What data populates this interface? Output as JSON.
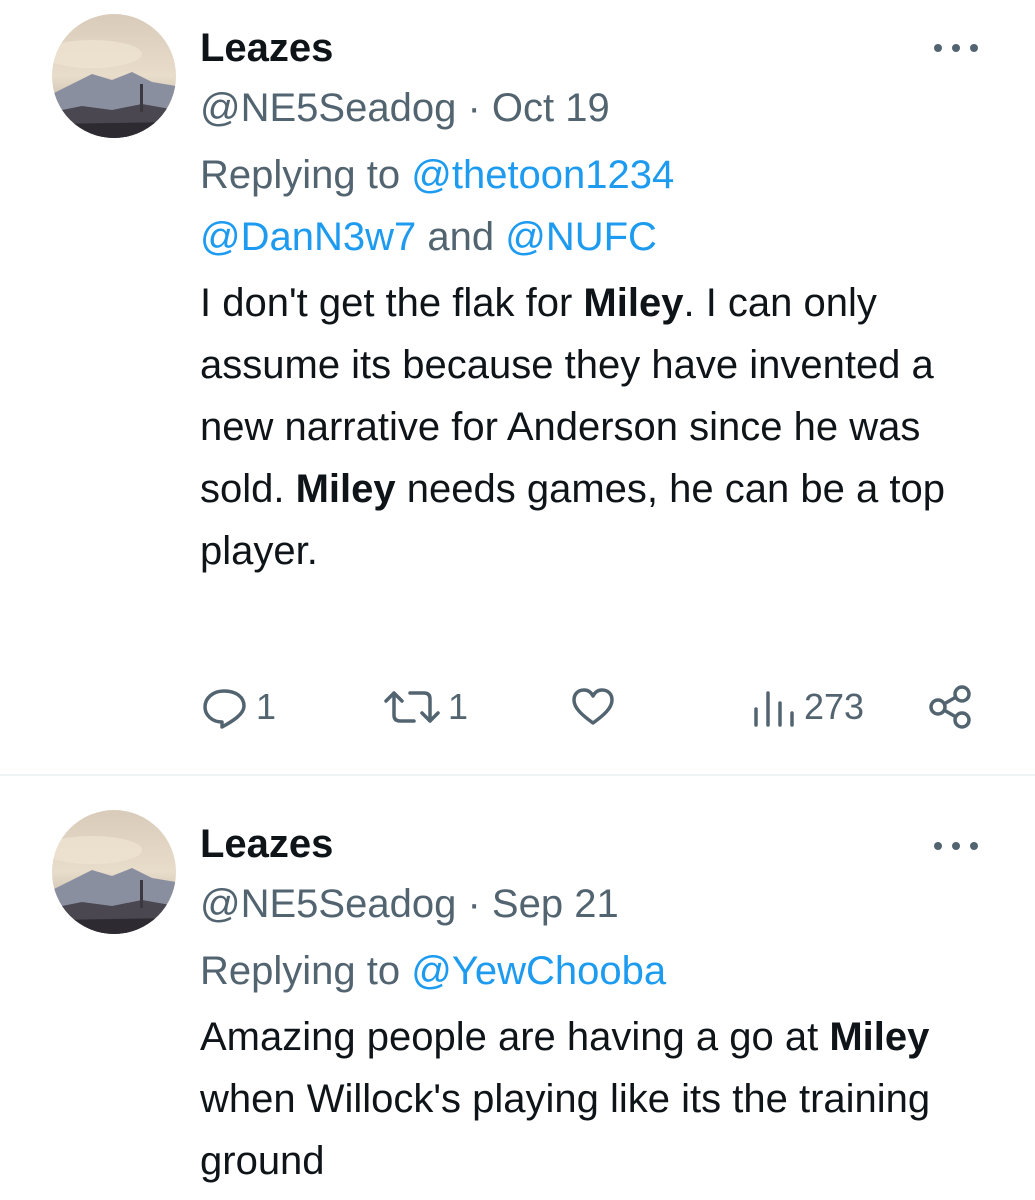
{
  "tweets": [
    {
      "author_name": "Leazes",
      "handle": "@NE5Seadog",
      "sep": "·",
      "date": "Oct 19",
      "replying_prefix": "Replying to ",
      "mention_1": "@thetoon1234",
      "mention_2": "@DanN3w7",
      "and_text": " and ",
      "mention_3": "@NUFC",
      "body": {
        "p1": "I don't get the flak for ",
        "b1": "Miley",
        "p2": ". I can only assume its because they have invented a new narrative for Anderson since he was sold. ",
        "b2": "Miley",
        "p3": " needs games, he can be a top player."
      },
      "replies_count": "1",
      "retweets_count": "1",
      "views_count": "273",
      "icons": [
        "more-icon",
        "reply-icon",
        "retweet-icon",
        "like-icon",
        "views-icon",
        "share-icon"
      ]
    },
    {
      "author_name": "Leazes",
      "handle": "@NE5Seadog",
      "sep": "·",
      "date": "Sep 21",
      "replying_prefix": "Replying to ",
      "mention_1": "@YewChooba",
      "body": {
        "p1": "Amazing people are having a go at ",
        "b1": "Miley",
        "p2": " when Willock's playing like its the training ground"
      },
      "icons": [
        "more-icon"
      ]
    }
  ],
  "colors": {
    "accent": "#1d9bf0",
    "secondary": "#536471",
    "text": "#0f1419",
    "divider": "#eff3f4"
  }
}
